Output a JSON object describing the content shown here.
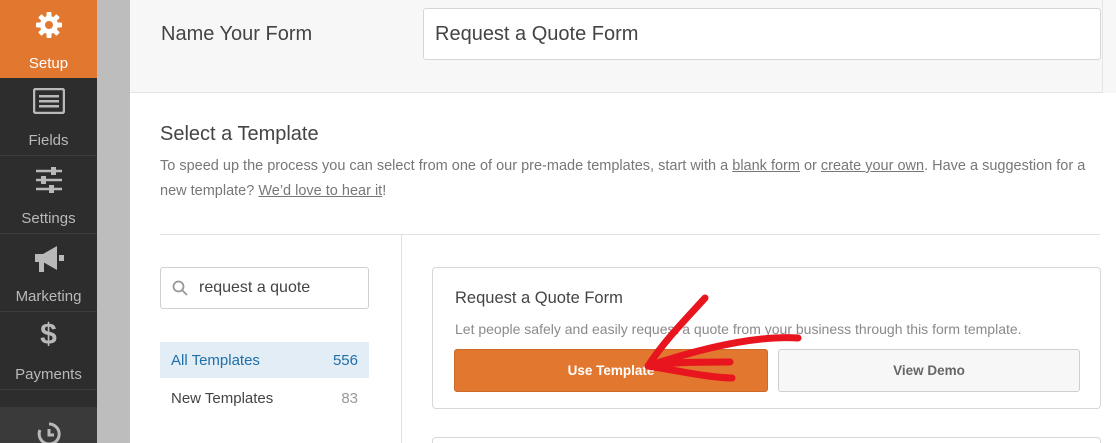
{
  "sidebar": {
    "items": [
      {
        "label": "Setup",
        "icon": "gear-icon"
      },
      {
        "label": "Fields",
        "icon": "fields-list-icon"
      },
      {
        "label": "Settings",
        "icon": "sliders-icon"
      },
      {
        "label": "Marketing",
        "icon": "megaphone-icon"
      },
      {
        "label": "Payments",
        "icon": "dollar-icon"
      },
      {
        "label": "",
        "icon": "history-icon"
      }
    ]
  },
  "header": {
    "name_label": "Name Your Form",
    "name_value": "Request a Quote Form"
  },
  "template_section": {
    "title": "Select a Template",
    "desc_part1": "To speed up the process you can select from one of our pre-made templates, start with a ",
    "link_blank": "blank form",
    "desc_part2": " or ",
    "link_create": "create your own",
    "desc_part3": ". Have a suggestion for a new template? ",
    "link_suggest": "We’d love to hear it",
    "desc_part4": "!"
  },
  "search": {
    "value": "request a quote"
  },
  "categories": [
    {
      "label": "All Templates",
      "count": "556"
    },
    {
      "label": "New Templates",
      "count": "83"
    }
  ],
  "card": {
    "title": "Request a Quote Form",
    "description": "Let people safely and easily request a quote from your business through this form template.",
    "use_label": "Use Template",
    "demo_label": "View Demo"
  },
  "colors": {
    "accent": "#e27730",
    "sidebar": "#2d2d2d",
    "active_category": "#e2edf6"
  }
}
